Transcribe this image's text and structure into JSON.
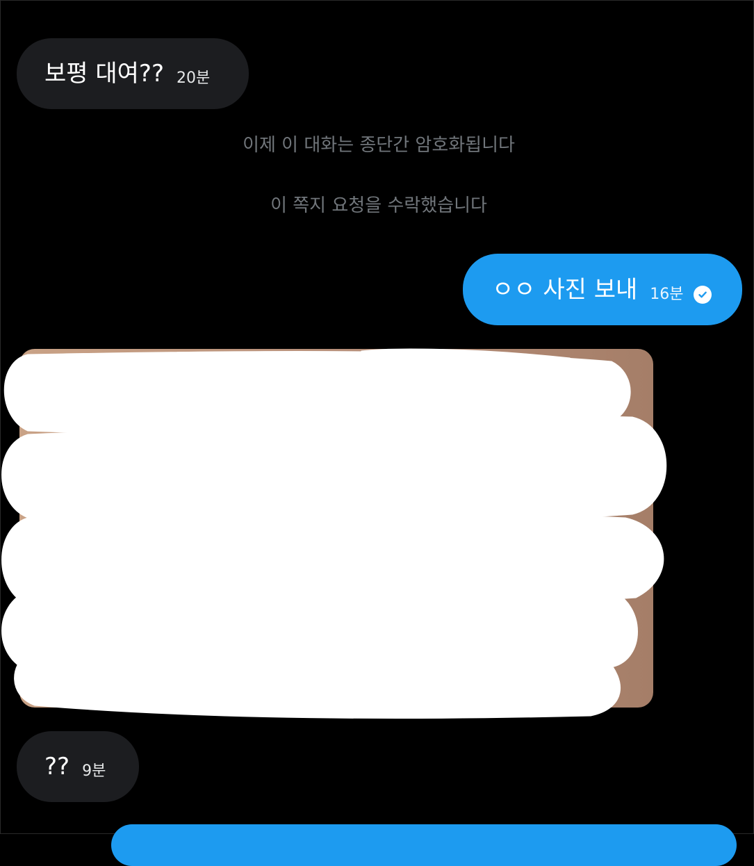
{
  "messages": [
    {
      "direction": "incoming",
      "text": "보평 대여??",
      "time": "20분"
    },
    {
      "direction": "outgoing",
      "text": "ㅇㅇ 사진 보내",
      "time": "16분",
      "status_icon": "read-check-icon"
    },
    {
      "direction": "incoming",
      "text": "??",
      "time": "9분"
    }
  ],
  "system_notices": [
    "이제 이 대화는 종단간 암호화됩니다",
    "이 쪽지 요청을 수락했습니다"
  ],
  "colors": {
    "background": "#000000",
    "incoming_bubble": "#1c1d20",
    "outgoing_bubble": "#1d9bf0",
    "system_text": "#71767b",
    "redaction": "#ffffff"
  }
}
